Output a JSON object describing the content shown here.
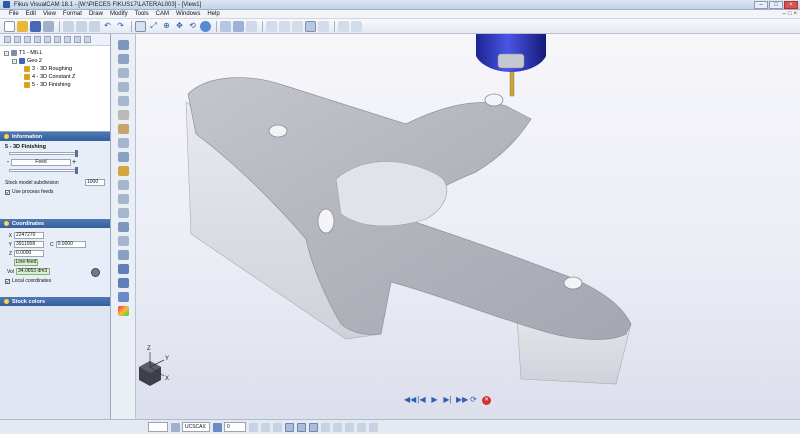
{
  "window": {
    "title": "Fikus VisualCAM 18.1 - [W:\\PIECES FIKUS17\\LATERAL003] - [View1]",
    "controls": [
      "–",
      "□",
      "×"
    ]
  },
  "menu": {
    "items": [
      "File",
      "Edit",
      "View",
      "Format",
      "Draw",
      "Modify",
      "Tools",
      "CAM",
      "Windows",
      "Help"
    ],
    "mdi_controls": [
      "–",
      "□",
      "×"
    ]
  },
  "tree": {
    "items": [
      {
        "label": "T1 - MILL",
        "level": 0,
        "expander": "−"
      },
      {
        "label": "Geo 2",
        "level": 1,
        "expander": "−"
      },
      {
        "label": "3 - 3D Roughing",
        "level": 2
      },
      {
        "label": "4 - 3D Constant Z",
        "level": 2
      },
      {
        "label": "5 - 3D Finishing",
        "level": 2
      }
    ]
  },
  "information": {
    "header": "Information",
    "operation": "5 - 3D Finishing",
    "feed_label": "Feed",
    "minus": "-",
    "plus": "+",
    "subdivision_label": "Stock model subdivision",
    "subdivision_value": "1000",
    "use_feeds_label": "Use process feeds",
    "use_feeds_checked": "✔"
  },
  "coordinates": {
    "header": "Coordinates",
    "x_label": "X",
    "x": "2247270",
    "y_label": "Y",
    "y": "3911958",
    "c_label": "C",
    "c": "0.0000",
    "z_label": "Z",
    "z": "0.0000",
    "mode": "Line-feed",
    "vol_label": "Vol",
    "vol": "34.0653 dm3",
    "local_label": "Local coordinates",
    "local_checked": "✔"
  },
  "stock_colors": {
    "header": "Stock colors"
  },
  "axis": {
    "z": "Z",
    "y": "Y",
    "x": "X"
  },
  "playback": {
    "buttons": [
      "◀◀",
      "|◀",
      "▶",
      "▶|",
      "▶▶",
      "⟳",
      "✕"
    ]
  },
  "status": {
    "cs": "UCSCAX",
    "layer": "0"
  },
  "colors": {
    "accent": "#355f9c",
    "tool_blue": "#2a34c9"
  }
}
